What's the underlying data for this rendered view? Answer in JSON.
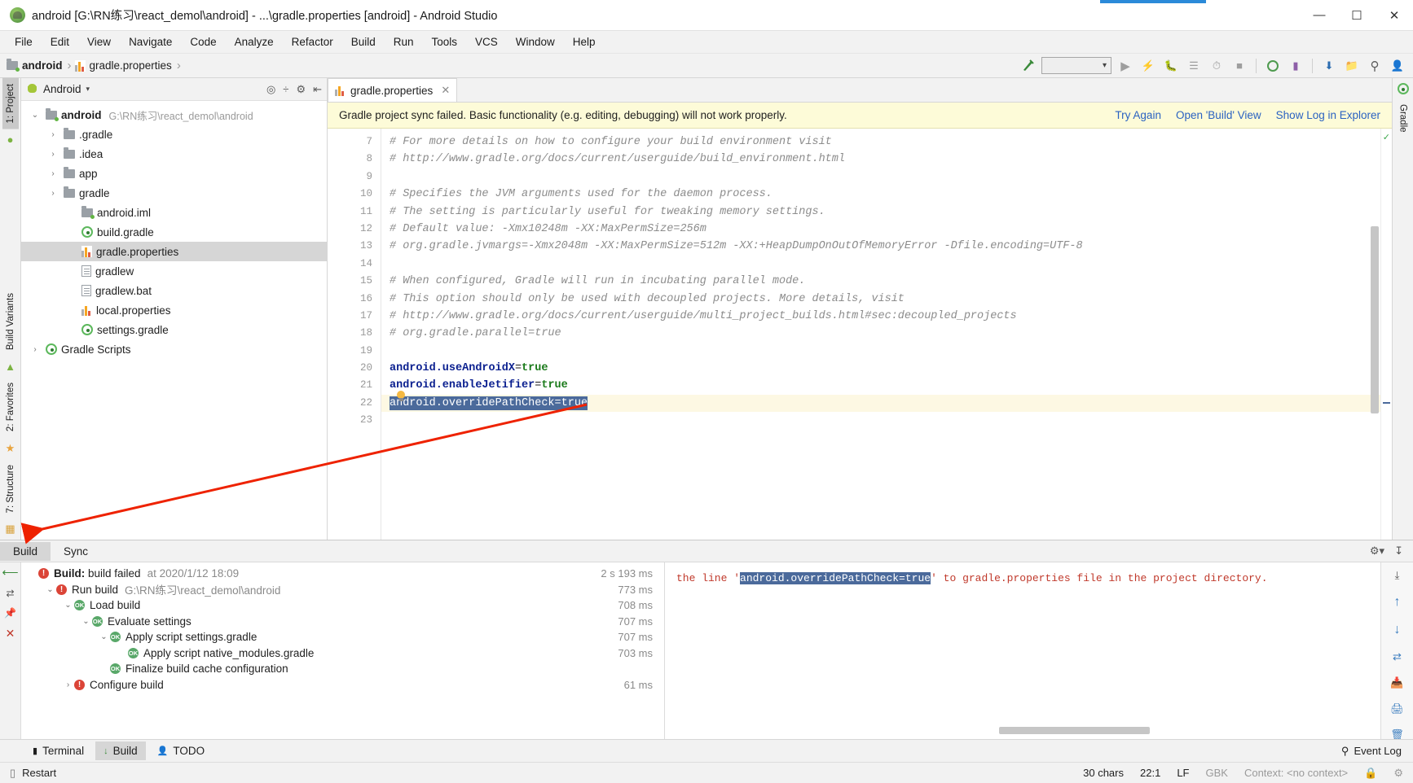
{
  "window": {
    "title": "android [G:\\RN练习\\react_demol\\android] - ...\\gradle.properties [android] - Android Studio",
    "logo_icon": "android-studio-logo",
    "minimize": "—",
    "maximize": "☐",
    "close": "✕"
  },
  "menubar": {
    "items": [
      "File",
      "Edit",
      "View",
      "Navigate",
      "Code",
      "Analyze",
      "Refactor",
      "Build",
      "Run",
      "Tools",
      "VCS",
      "Window",
      "Help"
    ]
  },
  "navbar": {
    "crumbs": [
      {
        "label": "android",
        "icon": "module-folder-icon"
      },
      {
        "label": "gradle.properties",
        "icon": "properties-file-icon"
      }
    ],
    "separator": "›",
    "toolbar_icons": [
      "make-project-icon",
      "run-configurations-dropdown",
      "run-icon",
      "apply-changes-icon",
      "debug-icon",
      "profile-icon",
      "attach-debugger-icon",
      "stop-icon",
      "sync-gradle-icon",
      "avd-manager-icon",
      "sdk-manager-icon",
      "project-structure-icon",
      "search-everywhere-icon",
      "user-account-icon"
    ],
    "run_config_value": ""
  },
  "left_strip": {
    "tabs": [
      {
        "label": "1: Project",
        "active": true,
        "icon": "project-icon"
      },
      {
        "label": "Build Variants",
        "active": false,
        "icon": "android-icon"
      },
      {
        "label": "2: Favorites",
        "active": false,
        "icon": "star-icon"
      },
      {
        "label": "7: Structure",
        "active": false,
        "icon": "structure-icon"
      }
    ]
  },
  "right_strip": {
    "tabs": [
      {
        "label": "Gradle",
        "icon": "gradle-icon"
      }
    ]
  },
  "project_panel": {
    "scope_label": "Android",
    "scope_icon": "android-icon",
    "header_icons": [
      "locate-icon",
      "collapse-all-icon",
      "settings-icon",
      "hide-icon"
    ],
    "tree": [
      {
        "indent": 0,
        "arrow": "⌄",
        "icon": "module-folder-icon",
        "label": "android",
        "bold": true,
        "path": "G:\\RN练习\\react_demol\\android",
        "selected": false
      },
      {
        "indent": 1,
        "arrow": "›",
        "icon": "folder-icon",
        "label": ".gradle",
        "bold": false,
        "path": "",
        "selected": false
      },
      {
        "indent": 1,
        "arrow": "›",
        "icon": "folder-icon",
        "label": ".idea",
        "bold": false,
        "path": "",
        "selected": false
      },
      {
        "indent": 1,
        "arrow": "›",
        "icon": "folder-icon",
        "label": "app",
        "bold": false,
        "path": "",
        "selected": false
      },
      {
        "indent": 1,
        "arrow": "›",
        "icon": "folder-icon",
        "label": "gradle",
        "bold": false,
        "path": "",
        "selected": false
      },
      {
        "indent": 2,
        "arrow": "",
        "icon": "module-folder-icon",
        "label": "android.iml",
        "bold": false,
        "path": "",
        "selected": false
      },
      {
        "indent": 2,
        "arrow": "",
        "icon": "gradle-icon",
        "label": "build.gradle",
        "bold": false,
        "path": "",
        "selected": false
      },
      {
        "indent": 2,
        "arrow": "",
        "icon": "properties-file-icon",
        "label": "gradle.properties",
        "bold": false,
        "path": "",
        "selected": true
      },
      {
        "indent": 2,
        "arrow": "",
        "icon": "text-file-icon",
        "label": "gradlew",
        "bold": false,
        "path": "",
        "selected": false
      },
      {
        "indent": 2,
        "arrow": "",
        "icon": "text-file-icon",
        "label": "gradlew.bat",
        "bold": false,
        "path": "",
        "selected": false
      },
      {
        "indent": 2,
        "arrow": "",
        "icon": "properties-file-icon",
        "label": "local.properties",
        "bold": false,
        "path": "",
        "selected": false
      },
      {
        "indent": 2,
        "arrow": "",
        "icon": "gradle-icon",
        "label": "settings.gradle",
        "bold": false,
        "path": "",
        "selected": false
      },
      {
        "indent": 0,
        "arrow": "›",
        "icon": "gradle-icon",
        "label": "Gradle Scripts",
        "bold": false,
        "path": "",
        "selected": false
      }
    ]
  },
  "editor": {
    "tab": {
      "label": "gradle.properties",
      "icon": "properties-file-icon",
      "close": "✕"
    },
    "notification": {
      "message": "Gradle project sync failed. Basic functionality (e.g. editing, debugging) will not work properly.",
      "links": [
        "Try Again",
        "Open 'Build' View",
        "Show Log in Explorer"
      ]
    },
    "first_line_number": 7,
    "lines": [
      {
        "n": 7,
        "kind": "comment",
        "text": "# For more details on how to configure your build environment visit"
      },
      {
        "n": 8,
        "kind": "comment",
        "text": "# http://www.gradle.org/docs/current/userguide/build_environment.html"
      },
      {
        "n": 9,
        "kind": "blank",
        "text": ""
      },
      {
        "n": 10,
        "kind": "comment",
        "text": "# Specifies the JVM arguments used for the daemon process."
      },
      {
        "n": 11,
        "kind": "comment",
        "text": "# The setting is particularly useful for tweaking memory settings."
      },
      {
        "n": 12,
        "kind": "comment",
        "text": "# Default value: -Xmx10248m -XX:MaxPermSize=256m"
      },
      {
        "n": 13,
        "kind": "comment",
        "text": "# org.gradle.jvmargs=-Xmx2048m -XX:MaxPermSize=512m -XX:+HeapDumpOnOutOfMemoryError -Dfile.encoding=UTF-8"
      },
      {
        "n": 14,
        "kind": "blank",
        "text": ""
      },
      {
        "n": 15,
        "kind": "comment",
        "text": "# When configured, Gradle will run in incubating parallel mode."
      },
      {
        "n": 16,
        "kind": "comment",
        "text": "# This option should only be used with decoupled projects. More details, visit"
      },
      {
        "n": 17,
        "kind": "comment",
        "text": "# http://www.gradle.org/docs/current/userguide/multi_project_builds.html#sec:decoupled_projects"
      },
      {
        "n": 18,
        "kind": "comment",
        "text": "# org.gradle.parallel=true"
      },
      {
        "n": 19,
        "kind": "blank",
        "text": ""
      },
      {
        "n": 20,
        "kind": "prop",
        "key": "android.useAndroidX",
        "value": "true"
      },
      {
        "n": 21,
        "kind": "prop",
        "key": "android.enableJetifier",
        "value": "true"
      },
      {
        "n": 22,
        "kind": "prop-selected",
        "key": "android.overridePathCheck",
        "value": "true",
        "text": "android.overridePathCheck=true"
      },
      {
        "n": 23,
        "kind": "blank",
        "text": ""
      }
    ]
  },
  "build_window": {
    "tabs": [
      {
        "label": "Build",
        "active": true
      },
      {
        "label": "Sync",
        "active": false
      }
    ],
    "header_icons": [
      "settings-gear-icon",
      "hide-window-icon"
    ],
    "left_icons": [
      "restart-icon",
      "toggle-soft-wrap-icon",
      "pin-icon",
      "close-icon"
    ],
    "tree": [
      {
        "indent": 0,
        "arrow": "",
        "status": "error",
        "bold_label": "Build:",
        "label": "build failed",
        "sub": "at 2020/1/12 18:09",
        "time": "2 s 193 ms"
      },
      {
        "indent": 1,
        "arrow": "⌄",
        "status": "error",
        "bold_label": "",
        "label": "Run build",
        "sub": "G:\\RN练习\\react_demol\\android",
        "time": "773 ms"
      },
      {
        "indent": 2,
        "arrow": "⌄",
        "status": "ok",
        "bold_label": "",
        "label": "Load build",
        "sub": "",
        "time": "708 ms"
      },
      {
        "indent": 3,
        "arrow": "⌄",
        "status": "ok",
        "bold_label": "",
        "label": "Evaluate settings",
        "sub": "",
        "time": "707 ms"
      },
      {
        "indent": 4,
        "arrow": "⌄",
        "status": "ok",
        "bold_label": "",
        "label": "Apply script settings.gradle",
        "sub": "",
        "time": "707 ms"
      },
      {
        "indent": 5,
        "arrow": "",
        "status": "ok",
        "bold_label": "",
        "label": "Apply script native_modules.gradle",
        "sub": "",
        "time": "703 ms"
      },
      {
        "indent": 4,
        "arrow": "",
        "status": "ok",
        "bold_label": "",
        "label": "Finalize build cache configuration",
        "sub": "",
        "time": ""
      },
      {
        "indent": 2,
        "arrow": "›",
        "status": "error",
        "bold_label": "",
        "label": "Configure build",
        "sub": "",
        "time": "61 ms"
      }
    ],
    "detail": {
      "prefix": "the line '",
      "highlight": "android.overridePathCheck=true",
      "suffix": "' to gradle.properties file in the project directory."
    },
    "right_icons": [
      "export-icon",
      "prev-occurrence-icon",
      "next-occurrence-icon",
      "filter-icon",
      "export-to-file-icon",
      "print-icon",
      "delete-icon"
    ]
  },
  "bottom_tabs": {
    "items": [
      {
        "label": "Terminal",
        "icon": "terminal-icon",
        "active": false
      },
      {
        "label": "Build",
        "icon": "build-icon",
        "active": true
      },
      {
        "label": "TODO",
        "icon": "todo-icon",
        "active": false
      }
    ],
    "event_log": {
      "label": "Event Log",
      "icon": "event-log-icon"
    }
  },
  "status_bar": {
    "restart_label": "Restart",
    "restart_icon": "restart-terminal-icon",
    "chars": "30 chars",
    "caret": "22:1",
    "line_separator": "LF",
    "encoding": "GBK",
    "context": "Context: <no context>",
    "lock_icon": "lock-icon",
    "inspector_icon": "inspector-icon"
  },
  "colors": {
    "accent_blue": "#2a62c1",
    "selection_blue": "#4b6a9b",
    "notification_yellow": "#fdfbd8",
    "error_red": "#db4437",
    "ok_green": "#59a869",
    "annotation_red": "#ee2200"
  }
}
